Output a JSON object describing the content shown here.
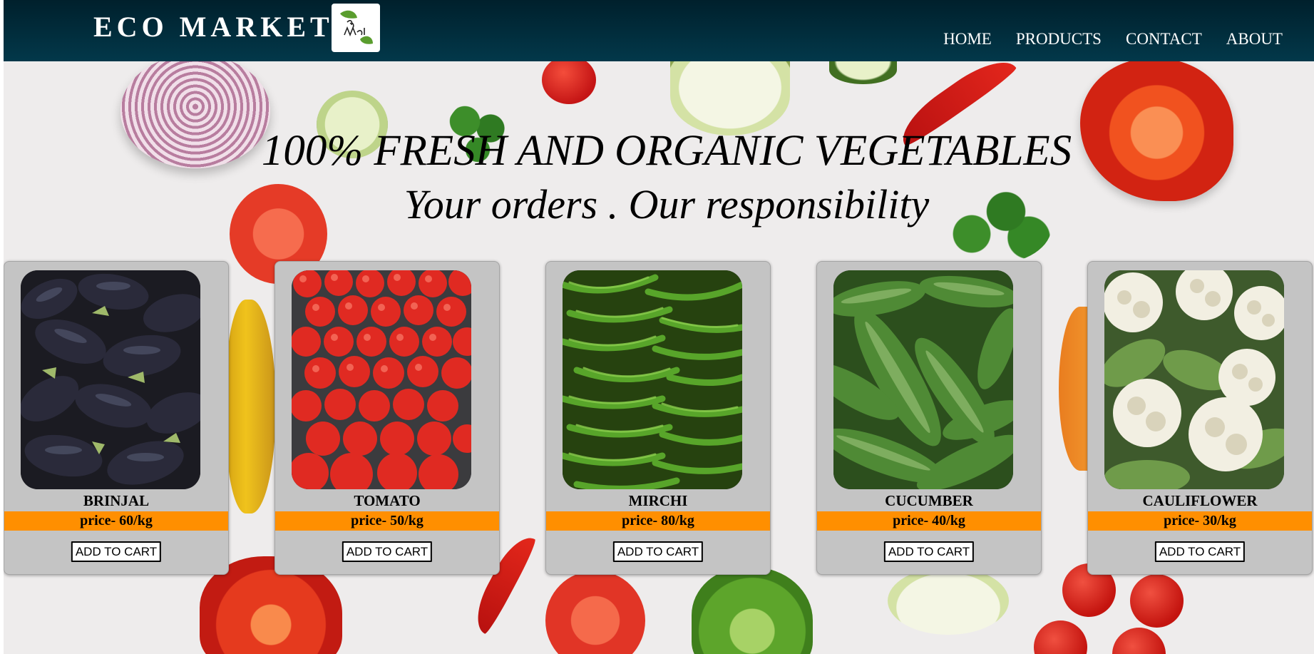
{
  "header": {
    "brand": "ECO MARKET",
    "logo_text": "Eco Market",
    "background": "#02384a",
    "nav": [
      {
        "label": "HOME"
      },
      {
        "label": "PRODUCTS"
      },
      {
        "label": "CONTACT"
      },
      {
        "label": "ABOUT"
      }
    ]
  },
  "hero": {
    "title": "100% FRESH AND ORGANIC VEGETABLES",
    "subtitle": "Your orders . Our responsibility"
  },
  "theme": {
    "price_band": "#ff8f00",
    "card_background": "#c4c4c4"
  },
  "products": [
    {
      "name": "BRINJAL",
      "price": "price- 60/kg",
      "button": "ADD TO CART",
      "image": "brinjal-photo"
    },
    {
      "name": "TOMATO",
      "price": "price- 50/kg",
      "button": "ADD TO CART",
      "image": "tomato-photo"
    },
    {
      "name": "MIRCHI",
      "price": "price- 80/kg",
      "button": "ADD TO CART",
      "image": "mirchi-photo"
    },
    {
      "name": "CUCUMBER",
      "price": "price- 40/kg",
      "button": "ADD TO CART",
      "image": "cucumber-photo"
    },
    {
      "name": "CAULIFLOWER",
      "price": "price- 30/kg",
      "button": "ADD TO CART",
      "image": "cauliflower-photo"
    }
  ]
}
